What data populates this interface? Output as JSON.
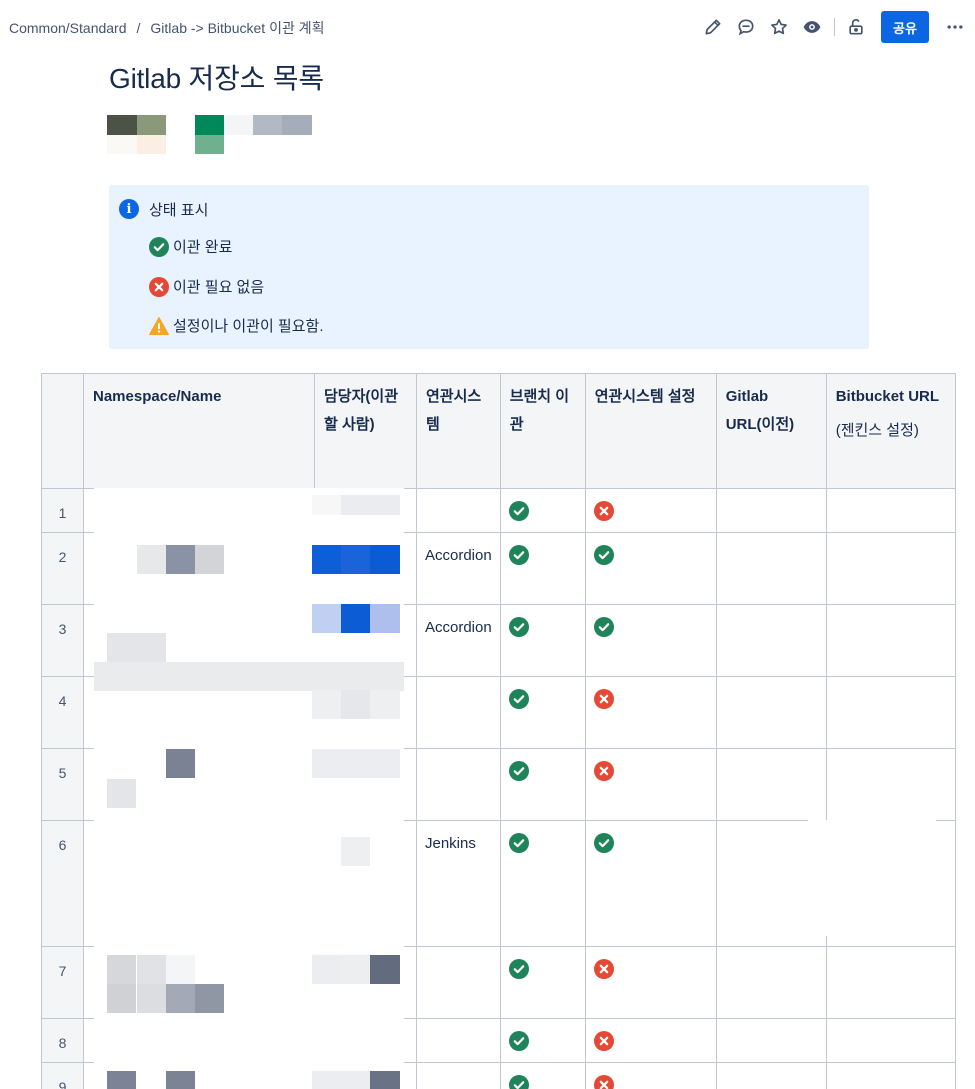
{
  "breadcrumb": {
    "space": "Common/Standard",
    "separator": "/",
    "parent": "Gitlab -> Bitbucket 이관 계획"
  },
  "toolbar": {
    "share_label": "공유",
    "icons": [
      "edit-icon",
      "comment-icon",
      "star-icon",
      "watch-icon",
      "restrictions-icon",
      "more-icon"
    ]
  },
  "page": {
    "title": "Gitlab 저장소 목록"
  },
  "info_panel": {
    "title": "상태 표시",
    "legend": [
      {
        "icon": "check-circle-icon",
        "label": "이관 완료"
      },
      {
        "icon": "cross-circle-icon",
        "label": "이관 필요 없음"
      },
      {
        "icon": "warning-icon",
        "label": "설정이나 이관이 필요함."
      }
    ]
  },
  "table": {
    "headers": {
      "num": "",
      "name": "Namespace/Name",
      "owner": "담당자(이관할 사람)",
      "system": "연관시스템",
      "branch": "브랜치 이관",
      "setting": "연관시스템 설정",
      "gitlab": "Gitlab URL(이전)",
      "bitbucket": "Bitbucket URL",
      "bitbucket_sub": "(젠킨스 설정)"
    },
    "rows": [
      {
        "num": "1",
        "system": "",
        "branch": "done",
        "setting": "none"
      },
      {
        "num": "2",
        "system": "Accordion",
        "branch": "done",
        "setting": "done"
      },
      {
        "num": "3",
        "system": "Accordion",
        "branch": "done",
        "setting": "done"
      },
      {
        "num": "4",
        "system": "",
        "branch": "done",
        "setting": "none"
      },
      {
        "num": "5",
        "system": "",
        "branch": "done",
        "setting": "none"
      },
      {
        "num": "6",
        "system": "Jenkins",
        "branch": "done",
        "setting": "done"
      },
      {
        "num": "7",
        "system": "",
        "branch": "done",
        "setting": "none"
      },
      {
        "num": "8",
        "system": "",
        "branch": "done",
        "setting": "none"
      },
      {
        "num": "9",
        "system": "",
        "branch": "done",
        "setting": "none"
      }
    ]
  },
  "colors": {
    "accent": "#0c66e4",
    "info_bg": "#e9f2ff",
    "success": "#1f845a",
    "danger": "#e34935",
    "warning": "#f5a623"
  }
}
